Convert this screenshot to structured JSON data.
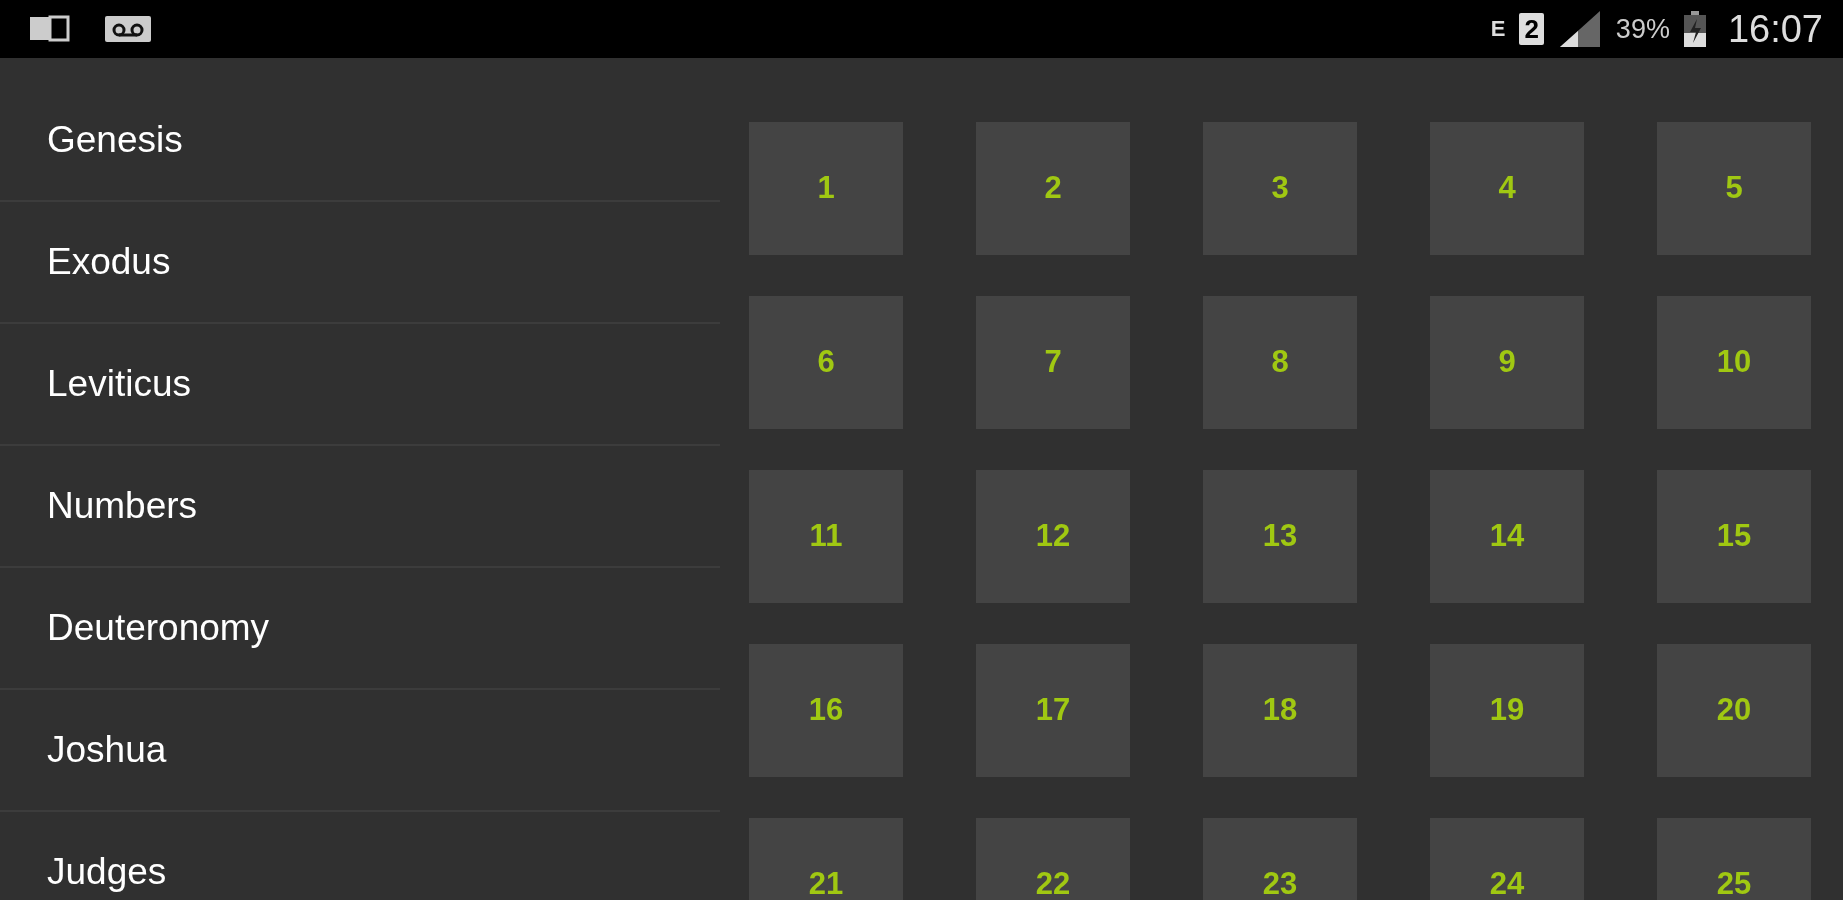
{
  "status_bar": {
    "network_type": "E",
    "sim": "2",
    "battery": "39%",
    "time": "16:07"
  },
  "books": [
    {
      "name": "Genesis"
    },
    {
      "name": "Exodus"
    },
    {
      "name": "Leviticus"
    },
    {
      "name": "Numbers"
    },
    {
      "name": "Deuteronomy"
    },
    {
      "name": "Joshua"
    },
    {
      "name": "Judges"
    }
  ],
  "chapters": [
    "1",
    "2",
    "3",
    "4",
    "5",
    "6",
    "7",
    "8",
    "9",
    "10",
    "11",
    "12",
    "13",
    "14",
    "15",
    "16",
    "17",
    "18",
    "19",
    "20",
    "21",
    "22",
    "23",
    "24",
    "25"
  ]
}
